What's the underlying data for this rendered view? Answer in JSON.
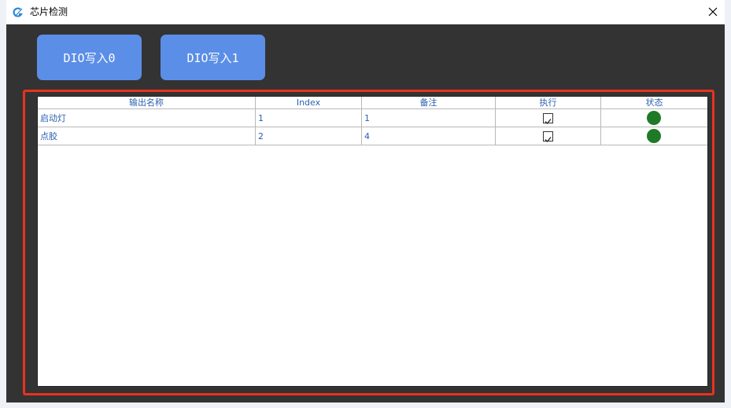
{
  "window": {
    "title": "芯片检测",
    "app_icon": "app-logo-icon",
    "close_icon": "close-icon"
  },
  "toolbar": {
    "dio_write_0_label": "DIO写入0",
    "dio_write_1_label": "DIO写入1"
  },
  "table": {
    "columns": [
      "输出名称",
      "Index",
      "备注",
      "执行",
      "状态"
    ],
    "rows": [
      {
        "name": "启动灯",
        "index": "1",
        "note": "1",
        "execute": true,
        "status": "on"
      },
      {
        "name": "点胶",
        "index": "2",
        "note": "4",
        "execute": true,
        "status": "on"
      }
    ]
  },
  "colors": {
    "button_bg": "#5b8ee6",
    "highlight_frame": "#e8321e",
    "status_on": "#1f7a27",
    "cell_text": "#2a5fb0"
  }
}
